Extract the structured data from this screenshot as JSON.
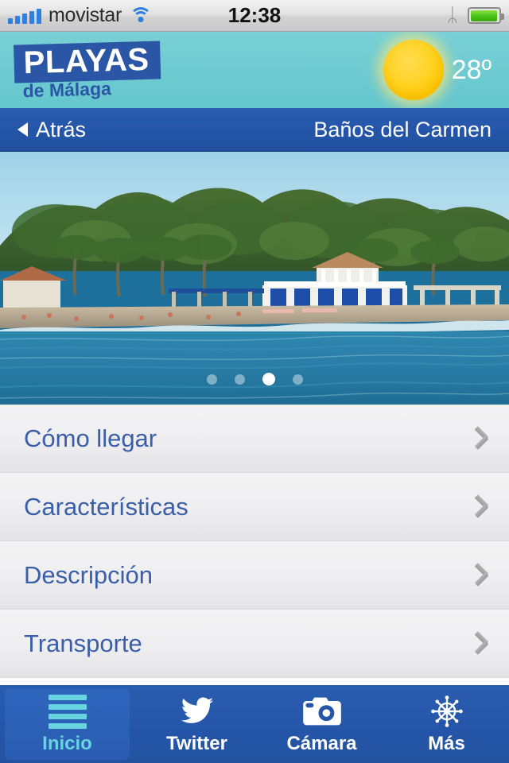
{
  "status_bar": {
    "carrier": "movistar",
    "time": "12:38",
    "signal_icon": "signal-bars-icon",
    "wifi_icon": "wifi-icon",
    "bluetooth_icon": "bluetooth-icon",
    "bluetooth_glyph": "ᛦ",
    "battery_icon": "battery-icon"
  },
  "brand_header": {
    "logo_top": "PLAYAS",
    "logo_sub": "de Málaga",
    "logo_bg_color": "#2b56a5",
    "header_bg_color": "#6ecbd2",
    "weather": {
      "icon": "sun-icon",
      "temperature": "28º"
    }
  },
  "nav_bar": {
    "back_label": "Atrás",
    "back_icon": "triangle-left-icon",
    "title": "Baños del Carmen",
    "bg_color": "#2455a8"
  },
  "photo_gallery": {
    "alt": "Playa de los Baños del Carmen: palmeras, arena y mar",
    "dots_total": 4,
    "dots_active_index": 2
  },
  "list": {
    "items": [
      {
        "label": "Cómo llegar",
        "chevron": "chevron-right-icon"
      },
      {
        "label": "Características",
        "chevron": "chevron-right-icon"
      },
      {
        "label": "Descripción",
        "chevron": "chevron-right-icon"
      },
      {
        "label": "Transporte",
        "chevron": "chevron-right-icon"
      }
    ],
    "text_color": "#3a5fa8"
  },
  "tab_bar": {
    "active_index": 0,
    "active_color": "#67d4e0",
    "bg_color": "#2455a8",
    "tabs": [
      {
        "label": "Inicio",
        "icon": "list-lines-icon"
      },
      {
        "label": "Twitter",
        "icon": "twitter-bird-icon"
      },
      {
        "label": "Cámara",
        "icon": "camera-icon"
      },
      {
        "label": "Más",
        "icon": "ship-wheel-icon"
      }
    ]
  }
}
